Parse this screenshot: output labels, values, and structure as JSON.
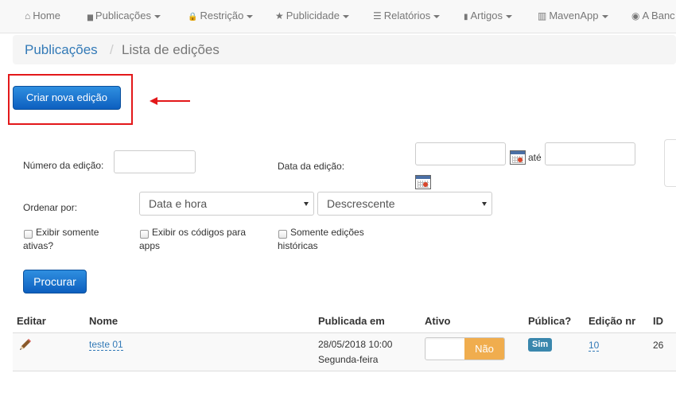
{
  "nav": [
    {
      "icon": "home-icon",
      "glyph": "⌂",
      "label": "Home",
      "dropdown": false
    },
    {
      "icon": "file-icon",
      "glyph": "▆",
      "label": "Publicações",
      "dropdown": true
    },
    {
      "icon": "lock-icon",
      "glyph": "🔒",
      "label": "Restrição",
      "dropdown": true
    },
    {
      "icon": "star-icon",
      "glyph": "★",
      "label": "Publicidade",
      "dropdown": true
    },
    {
      "icon": "list-icon",
      "glyph": "☰",
      "label": "Relatórios",
      "dropdown": true
    },
    {
      "icon": "bookmark-icon",
      "glyph": "▮",
      "label": "Artigos",
      "dropdown": true
    },
    {
      "icon": "barcode-icon",
      "glyph": "▥",
      "label": "MavenApp",
      "dropdown": true
    },
    {
      "icon": "globe-icon",
      "glyph": "◉",
      "label": "A Banc",
      "dropdown": false
    }
  ],
  "breadcrumb": {
    "parent": "Publicações",
    "separator": "/",
    "current": "Lista de edições"
  },
  "create_button": "Criar nova edição",
  "filters": {
    "number_label": "Número da edição:",
    "number_value": "",
    "date_label": "Data da edição:",
    "date_from": "",
    "date_to": "",
    "date_between": "até",
    "order_label": "Ordenar por:",
    "order_field": "Data e hora",
    "order_direction": "Descrescente",
    "checkbox_active": "Exibir somente ativas?",
    "checkbox_codes": "Exibir os códigos para apps",
    "checkbox_historical": "Somente edições históricas",
    "search_button": "Procurar"
  },
  "table": {
    "headers": [
      "Editar",
      "Nome",
      "Publicada em",
      "Ativo",
      "Pública?",
      "Edição nr",
      "ID"
    ],
    "rows": [
      {
        "name": "teste 01",
        "published_date": "28/05/2018 10:00",
        "published_day": "Segunda-feira",
        "active": "Não",
        "public": "Sim",
        "edition_nr": "10",
        "id": "26"
      }
    ]
  },
  "colors": {
    "primary": "#337ab7",
    "highlight": "#e3181a",
    "toggle_off": "#f0ad4e",
    "badge": "#3a87ad"
  }
}
